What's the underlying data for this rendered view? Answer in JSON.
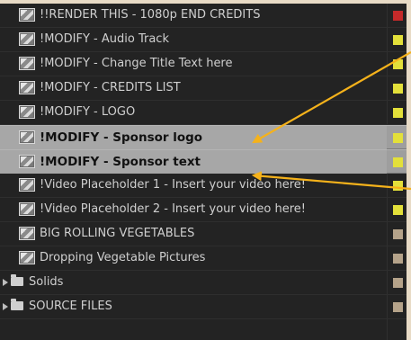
{
  "layers": [
    {
      "name": "!!RENDER THIS - 1080p END CREDITS",
      "type": "comp",
      "label_color": "#c42a2a",
      "selected": false
    },
    {
      "name": "!MODIFY - Audio Track",
      "type": "comp",
      "label_color": "#e3e03a",
      "selected": false
    },
    {
      "name": "!MODIFY - Change Title Text  here",
      "type": "comp",
      "label_color": "#e3e03a",
      "selected": false
    },
    {
      "name": "!MODIFY - CREDITS LIST",
      "type": "comp",
      "label_color": "#e3e03a",
      "selected": false
    },
    {
      "name": "!MODIFY - LOGO",
      "type": "comp",
      "label_color": "#e3e03a",
      "selected": false
    },
    {
      "name": "!MODIFY - Sponsor logo",
      "type": "comp",
      "label_color": "#e3e03a",
      "selected": true
    },
    {
      "name": "!MODIFY - Sponsor text",
      "type": "comp",
      "label_color": "#e3e03a",
      "selected": true
    },
    {
      "name": "!Video Placeholder 1 - Insert your video here!",
      "type": "comp",
      "label_color": "#e3e03a",
      "selected": false
    },
    {
      "name": "!Video Placeholder 2 - Insert your video here!",
      "type": "comp",
      "label_color": "#e3e03a",
      "selected": false
    },
    {
      "name": "BIG ROLLING VEGETABLES",
      "type": "comp",
      "label_color": "#b5a38a",
      "selected": false
    },
    {
      "name": "Dropping Vegetable Pictures",
      "type": "comp",
      "label_color": "#b5a38a",
      "selected": false
    },
    {
      "name": "Solids",
      "type": "folder",
      "label_color": "#b5a38a",
      "selected": false
    },
    {
      "name": "SOURCE FILES",
      "type": "folder",
      "label_color": "#b5a38a",
      "selected": false
    }
  ],
  "annotation_color": "#f5b21b",
  "icons": {
    "comp": "composition-icon",
    "folder": "folder-icon",
    "expand": "disclosure-triangle-icon"
  }
}
